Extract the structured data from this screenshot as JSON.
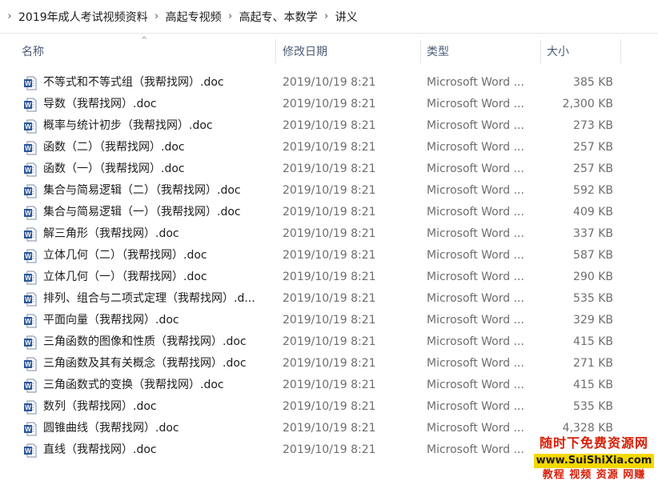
{
  "breadcrumb": [
    "2019年成人考试视频资料",
    "高起专视频",
    "高起专、本数学",
    "讲义"
  ],
  "columns": {
    "name": "名称",
    "date": "修改日期",
    "type": "类型",
    "size": "大小"
  },
  "files": [
    {
      "name": "不等式和不等式组（我帮找网）.doc",
      "date": "2019/10/19 8:21",
      "type": "Microsoft Word ...",
      "size": "385 KB"
    },
    {
      "name": "导数（我帮找网）.doc",
      "date": "2019/10/19 8:21",
      "type": "Microsoft Word ...",
      "size": "2,300 KB"
    },
    {
      "name": "概率与统计初步（我帮找网）.doc",
      "date": "2019/10/19 8:21",
      "type": "Microsoft Word ...",
      "size": "273 KB"
    },
    {
      "name": "函数（二）（我帮找网）.doc",
      "date": "2019/10/19 8:21",
      "type": "Microsoft Word ...",
      "size": "257 KB"
    },
    {
      "name": "函数（一）（我帮找网）.doc",
      "date": "2019/10/19 8:21",
      "type": "Microsoft Word ...",
      "size": "257 KB"
    },
    {
      "name": "集合与简易逻辑（二）（我帮找网）.doc",
      "date": "2019/10/19 8:21",
      "type": "Microsoft Word ...",
      "size": "592 KB"
    },
    {
      "name": "集合与简易逻辑（一）（我帮找网）.doc",
      "date": "2019/10/19 8:21",
      "type": "Microsoft Word ...",
      "size": "409 KB"
    },
    {
      "name": "解三角形（我帮找网）.doc",
      "date": "2019/10/19 8:21",
      "type": "Microsoft Word ...",
      "size": "337 KB"
    },
    {
      "name": "立体几何（二）（我帮找网）.doc",
      "date": "2019/10/19 8:21",
      "type": "Microsoft Word ...",
      "size": "587 KB"
    },
    {
      "name": "立体几何（一）（我帮找网）.doc",
      "date": "2019/10/19 8:21",
      "type": "Microsoft Word ...",
      "size": "290 KB"
    },
    {
      "name": "排列、组合与二项式定理（我帮找网）.d...",
      "date": "2019/10/19 8:21",
      "type": "Microsoft Word ...",
      "size": "535 KB"
    },
    {
      "name": "平面向量（我帮找网）.doc",
      "date": "2019/10/19 8:21",
      "type": "Microsoft Word ...",
      "size": "329 KB"
    },
    {
      "name": "三角函数的图像和性质（我帮找网）.doc",
      "date": "2019/10/19 8:21",
      "type": "Microsoft Word ...",
      "size": "415 KB"
    },
    {
      "name": "三角函数及其有关概念（我帮找网）.doc",
      "date": "2019/10/19 8:21",
      "type": "Microsoft Word ...",
      "size": "271 KB"
    },
    {
      "name": "三角函数式的变换（我帮找网）.doc",
      "date": "2019/10/19 8:21",
      "type": "Microsoft Word ...",
      "size": "415 KB"
    },
    {
      "name": "数列（我帮找网）.doc",
      "date": "2019/10/19 8:21",
      "type": "Microsoft Word ...",
      "size": "535 KB"
    },
    {
      "name": "圆锥曲线（我帮找网）.doc",
      "date": "2019/10/19 8:21",
      "type": "Microsoft Word ...",
      "size": "4,328 KB"
    },
    {
      "name": "直线（我帮找网）.doc",
      "date": "2019/10/19 8:21",
      "type": "Microsoft Word ...",
      "size": ""
    }
  ],
  "watermark": {
    "line1": "随时下免费资源网",
    "line2": "www.SuiShiXia.com",
    "line3": "教程 视频 资源 网赚"
  },
  "icons": {
    "file": "word-doc-icon",
    "sort": "sort-up-arrow-icon",
    "separator": "chevron-right-icon"
  },
  "colors": {
    "word_blue": "#2b579a",
    "header_text": "#4c5b76",
    "secondary_text": "#6d6d6d"
  }
}
